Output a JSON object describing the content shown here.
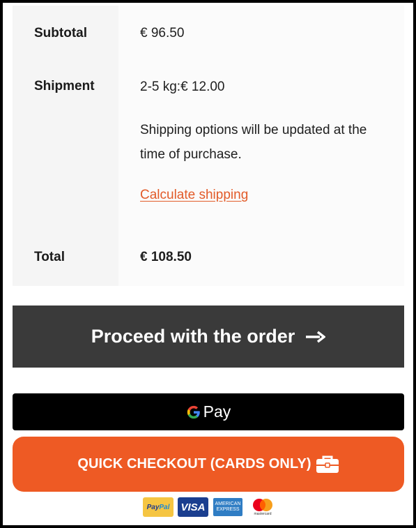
{
  "totals": {
    "subtotal": {
      "label": "Subtotal",
      "value": "€  96.50"
    },
    "shipment": {
      "label": "Shipment",
      "rate": "2-5 kg:€  12.00",
      "note": "Shipping options will be updated at the time of purchase.",
      "calculate_link": "Calculate shipping"
    },
    "total": {
      "label": "Total",
      "value": "€  108.50"
    }
  },
  "proceed_button": {
    "label": "Proceed with the order",
    "icon": "arrow-right-icon"
  },
  "gpay_button": {
    "label": "Pay",
    "icon": "google-g-icon"
  },
  "quick_checkout_button": {
    "label": "QUICK CHECKOUT (CARDS ONLY)",
    "icon": "briefcase-icon"
  },
  "payment_logos": {
    "paypal": {
      "text_pay": "Pay",
      "text_pal": "Pal"
    },
    "visa": "VISA",
    "amex": [
      "AMERICAN",
      "EXPRESS"
    ],
    "mastercard": "mastercard"
  },
  "colors": {
    "accent": "#ee5a24",
    "link": "#e25b29",
    "proceed_bg": "#3a3a3a",
    "gpay_bg": "#000000"
  }
}
